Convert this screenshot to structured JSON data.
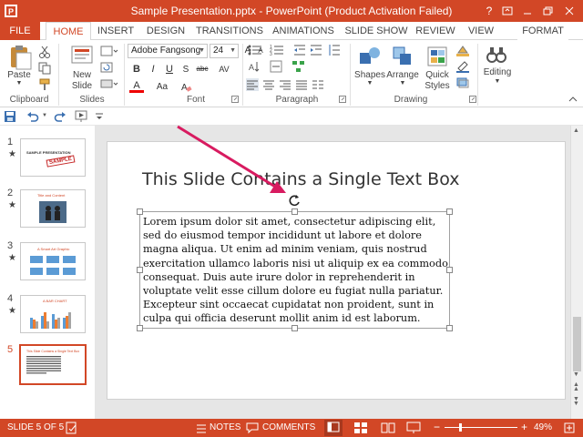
{
  "window": {
    "title": "Sample Presentation.pptx -  PowerPoint (Product Activation Failed)",
    "help_label": "?"
  },
  "tabs": {
    "file": "FILE",
    "items": [
      "HOME",
      "INSERT",
      "DESIGN",
      "TRANSITIONS",
      "ANIMATIONS",
      "SLIDE SHOW",
      "REVIEW",
      "VIEW",
      "FORMAT"
    ],
    "active": "HOME"
  },
  "ribbon": {
    "clipboard": {
      "paste_label": "Paste",
      "group_label": "Clipboard"
    },
    "slides": {
      "new_slide_line1": "New",
      "new_slide_line2": "Slide",
      "group_label": "Slides"
    },
    "font": {
      "font_name": "Adobe Fangsong",
      "font_size": "24",
      "bold": "B",
      "italic": "I",
      "underline": "U",
      "strike": "S",
      "shadow": "abc",
      "spacing": "AV",
      "color": "A",
      "size_change": "Aa",
      "grow": "A",
      "shrink": "A",
      "group_label": "Font"
    },
    "paragraph": {
      "group_label": "Paragraph"
    },
    "drawing": {
      "shapes_label": "Shapes",
      "arrange_label": "Arrange",
      "quick_line1": "Quick",
      "quick_line2": "Styles",
      "group_label": "Drawing"
    },
    "editing": {
      "label": "Editing"
    }
  },
  "thumbnails": [
    {
      "num": "1",
      "star": "★",
      "caption": "SAMPLE PRESENTATION",
      "stamp": "SAMPLE"
    },
    {
      "num": "2",
      "star": "★",
      "caption": "Title and Content"
    },
    {
      "num": "3",
      "star": "★",
      "caption": "A Smart Art Graphic"
    },
    {
      "num": "4",
      "star": "★",
      "caption": "A BAR CHART"
    },
    {
      "num": "5",
      "star": "",
      "caption": "This Slide Contains a Single Text Box"
    }
  ],
  "slide": {
    "title": "This Slide Contains a Single Text Box",
    "body": "Lorem ipsum dolor sit amet, consectetur adipiscing elit, sed do eiusmod tempor incididunt ut labore et dolore magna aliqua. Ut enim ad minim veniam, quis nostrud exercitation ullamco laboris nisi ut aliquip ex ea commodo consequat. Duis aute irure dolor in reprehenderit in voluptate velit esse cillum dolore eu fugiat nulla pariatur. Excepteur sint occaecat cupidatat non proident, sunt in culpa qui officia deserunt mollit anim id est laborum."
  },
  "status": {
    "slide_info": "SLIDE 5 OF 5",
    "notes": "NOTES",
    "comments": "COMMENTS",
    "zoom": "49%",
    "zoom_minus": "−",
    "zoom_plus": "+"
  },
  "colors": {
    "accent": "#d24726",
    "annotation_arrow": "#d81b60"
  }
}
